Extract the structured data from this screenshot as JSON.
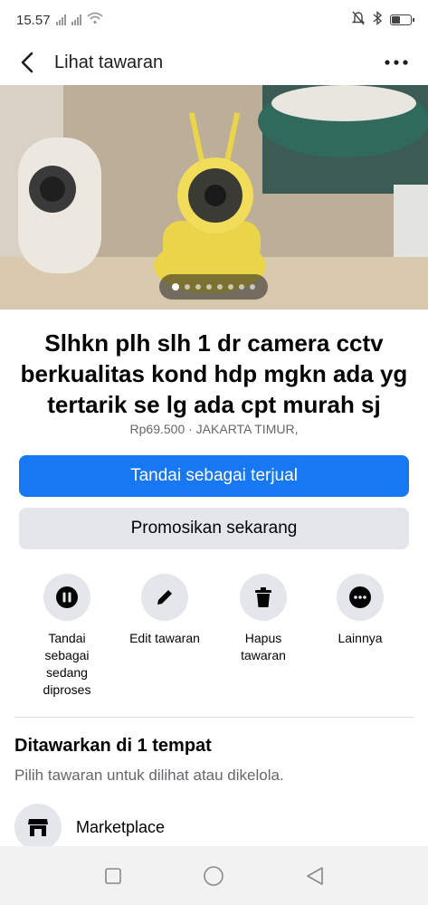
{
  "status_bar": {
    "time": "15.57"
  },
  "header": {
    "title": "Lihat tawaran"
  },
  "gallery": {
    "photo_count": 8,
    "active_index": 0
  },
  "listing": {
    "title": "Slhkn plh slh 1 dr camera cctv berkualitas kond hdp mgkn ada yg tertarik se lg ada cpt murah sj",
    "meta": "Rp69.500 · JAKARTA TIMUR,"
  },
  "buttons": {
    "mark_sold": "Tandai sebagai terjual",
    "promote": "Promosikan sekarang"
  },
  "actions": [
    {
      "icon": "pause-icon",
      "label": "Tandai sebagai sedang diproses"
    },
    {
      "icon": "pencil-icon",
      "label": "Edit tawaran"
    },
    {
      "icon": "trash-icon",
      "label": "Hapus tawaran"
    },
    {
      "icon": "more-icon",
      "label": "Lainnya"
    }
  ],
  "offered_section": {
    "title": "Ditawarkan di 1 tempat",
    "subtitle": "Pilih tawaran untuk dilihat atau dikelola.",
    "places": [
      {
        "icon": "marketplace-icon",
        "label": "Marketplace"
      }
    ]
  },
  "colors": {
    "primary": "#1877f2",
    "secondary_bg": "#e4e6eb",
    "muted_text": "#65676b"
  }
}
